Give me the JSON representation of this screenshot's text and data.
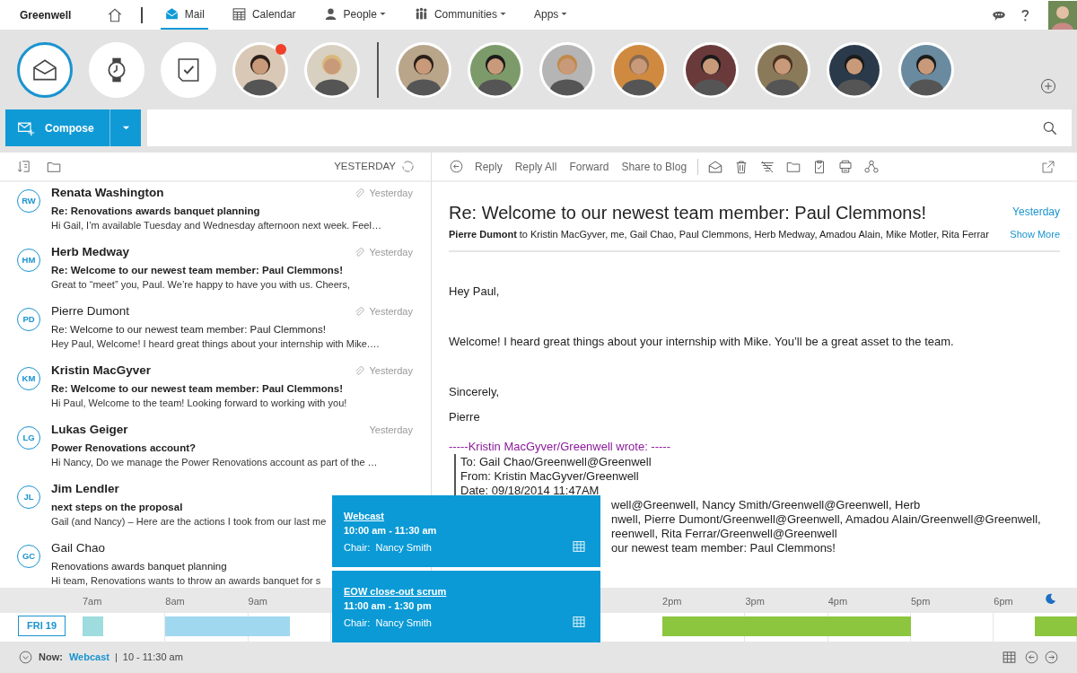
{
  "nav": {
    "brand": "Greenwell",
    "tabs": [
      {
        "label": "Mail",
        "selected": true,
        "dropdown": false
      },
      {
        "label": "Calendar",
        "selected": false,
        "dropdown": false
      },
      {
        "label": "People",
        "selected": false,
        "dropdown": true
      },
      {
        "label": "Communities",
        "selected": false,
        "dropdown": true
      },
      {
        "label": "Apps",
        "selected": false,
        "dropdown": true
      }
    ]
  },
  "shortcuts": [
    {
      "kind": "mail",
      "selected": true
    },
    {
      "kind": "watch",
      "selected": false
    },
    {
      "kind": "task",
      "selected": false
    }
  ],
  "favorites": [
    {
      "notification": true
    },
    {
      "notification": false
    }
  ],
  "contacts": [
    {
      "notification": false
    },
    {
      "notification": false
    },
    {
      "notification": false
    },
    {
      "notification": false
    },
    {
      "notification": false
    },
    {
      "notification": false
    },
    {
      "notification": false
    },
    {
      "notification": false
    }
  ],
  "compose": {
    "label": "Compose"
  },
  "list_toolbar": {
    "date_filter": "YESTERDAY"
  },
  "messages": [
    {
      "initials": "RW",
      "sender": "Renata Washington",
      "subject": "Re: Renovations awards banquet planning",
      "preview": "Hi Gail, I’m available Tuesday and Wednesday afternoon next week. Feel…",
      "date": "Yesterday",
      "attachment": true,
      "unread": true
    },
    {
      "initials": "HM",
      "sender": "Herb Medway",
      "subject": "Re: Welcome to our newest team member: Paul Clemmons!",
      "preview": "Great to “meet” you, Paul. We’re happy to have you with us. Cheers,",
      "date": "Yesterday",
      "attachment": true,
      "unread": true
    },
    {
      "initials": "PD",
      "sender": "Pierre Dumont",
      "subject": "Re: Welcome to our newest team member: Paul Clemmons!",
      "preview": "Hey Paul, Welcome! I heard great things about your internship with Mike.…",
      "date": "Yesterday",
      "attachment": true,
      "unread": false
    },
    {
      "initials": "KM",
      "sender": "Kristin MacGyver",
      "subject": "Re: Welcome to our newest team member: Paul Clemmons!",
      "preview": "Hi Paul, Welcome to the team! Looking forward to working with you!",
      "date": "Yesterday",
      "attachment": true,
      "unread": true
    },
    {
      "initials": "LG",
      "sender": "Lukas Geiger",
      "subject": "Power Renovations account?",
      "preview": "Hi Nancy, Do we manage the Power Renovations account as part of the …",
      "date": "Yesterday",
      "attachment": false,
      "unread": true
    },
    {
      "initials": "JL",
      "sender": "Jim Lendler",
      "subject": "next steps on the proposal",
      "preview": "Gail (and Nancy) – Here are the actions I took from our last me",
      "attachment": false,
      "unread": true
    },
    {
      "initials": "GC",
      "sender": "Gail Chao",
      "subject": "Renovations awards banquet planning",
      "preview": "Hi team, Renovations wants to throw an awards banquet for s",
      "attachment": false,
      "unread": false
    }
  ],
  "reader": {
    "actions": [
      "Reply",
      "Reply All",
      "Forward",
      "Share to Blog"
    ],
    "title": "Re: Welcome to our newest team member: Paul Clemmons!",
    "date": "Yesterday",
    "sender": "Pierre Dumont",
    "recipients": "to Kristin MacGyver, me, Gail Chao, Paul Clemmons, Herb Medway, Amadou Alain, Mike Motler, Rita Ferrar",
    "show_more": "Show More",
    "body": [
      "Hey Paul,",
      "Welcome! I heard great things about your internship with Mike. You’ll be a great asset to the team.",
      "Sincerely,",
      "Pierre"
    ],
    "quote_header": "-----Kristin MacGyver/Greenwell wrote: -----",
    "quote_lines": [
      "To: Gail Chao/Greenwell@Greenwell",
      "From: Kristin MacGyver/Greenwell",
      "Date: 09/18/2014 11:47AM"
    ],
    "quote_lines_behind_popup": [
      "well@Greenwell, Nancy Smith/Greenwell@Greenwell, Herb",
      "nwell, Pierre Dumont/Greenwell@Greenwell, Amadou Alain/Greenwell@Greenwell,",
      "reenwell, Rita Ferrar/Greenwell@Greenwell",
      "our newest team member: Paul Clemmons!"
    ]
  },
  "popups": [
    {
      "title": "Webcast",
      "time": "10:00 am - 11:30 am",
      "chair": "Chair:  Nancy Smith"
    },
    {
      "title": "EOW close-out scrum",
      "time": "11:00 am - 1:30 pm",
      "chair": "Chair:  Nancy Smith"
    }
  ],
  "timeline": {
    "day": "FRI 19",
    "night": true,
    "hours": [
      "7am",
      "8am",
      "9am",
      "2pm",
      "3pm",
      "4pm",
      "5pm",
      "6pm"
    ],
    "events": [
      {
        "color": "#9edcde"
      },
      {
        "color": "#a0d9ef"
      },
      {
        "color": "#8cc63f"
      },
      {
        "color": "#8cc63f"
      }
    ]
  },
  "status": {
    "label": "Now:",
    "event": "Webcast",
    "separator": "|",
    "time": "10 - 11:30 am"
  }
}
